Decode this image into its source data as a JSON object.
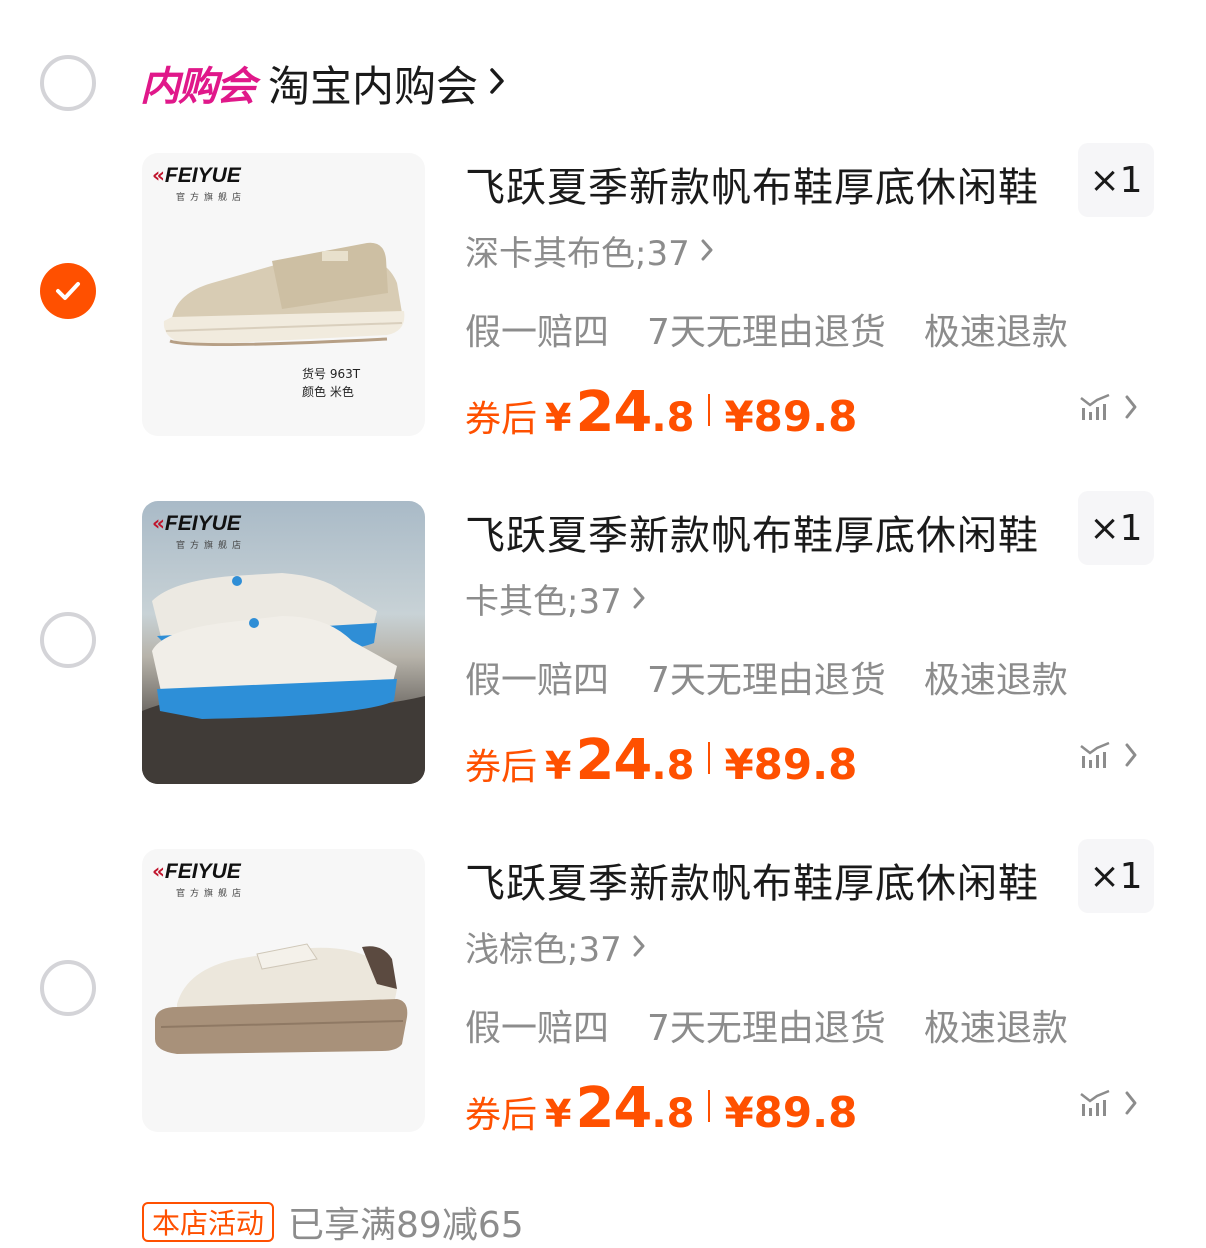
{
  "shop": {
    "logo_text": "内购会",
    "name": "淘宝内购会"
  },
  "brand": {
    "name": "FEIYUE",
    "sub": "官方旗舰店"
  },
  "items": [
    {
      "title": "飞跃夏季新款帆布鞋厚底休闲鞋",
      "spec": "深卡其布色;37",
      "quantity": "×1",
      "tags": [
        "假一赔四",
        "7天无理由退货",
        "极速退款"
      ],
      "price_label": "券后",
      "currency": "¥",
      "price_int": "24",
      "price_dec": ".8",
      "orig_price": "¥89.8",
      "sku_line1": "货号  963T",
      "sku_line2": "颜色  米色",
      "checked": true
    },
    {
      "title": "飞跃夏季新款帆布鞋厚底休闲鞋",
      "spec": "卡其色;37",
      "quantity": "×1",
      "tags": [
        "假一赔四",
        "7天无理由退货",
        "极速退款"
      ],
      "price_label": "券后",
      "currency": "¥",
      "price_int": "24",
      "price_dec": ".8",
      "orig_price": "¥89.8",
      "checked": false
    },
    {
      "title": "飞跃夏季新款帆布鞋厚底休闲鞋",
      "spec": "浅棕色;37",
      "quantity": "×1",
      "tags": [
        "假一赔四",
        "7天无理由退货",
        "极速退款"
      ],
      "price_label": "券后",
      "currency": "¥",
      "price_int": "24",
      "price_dec": ".8",
      "orig_price": "¥89.8",
      "checked": false
    }
  ],
  "promo": {
    "badge": "本店活动",
    "text": "已享满89减65"
  },
  "colors": {
    "accent": "#ff5000",
    "shop_logo": "#e0188a",
    "muted": "#8c8c8c"
  }
}
